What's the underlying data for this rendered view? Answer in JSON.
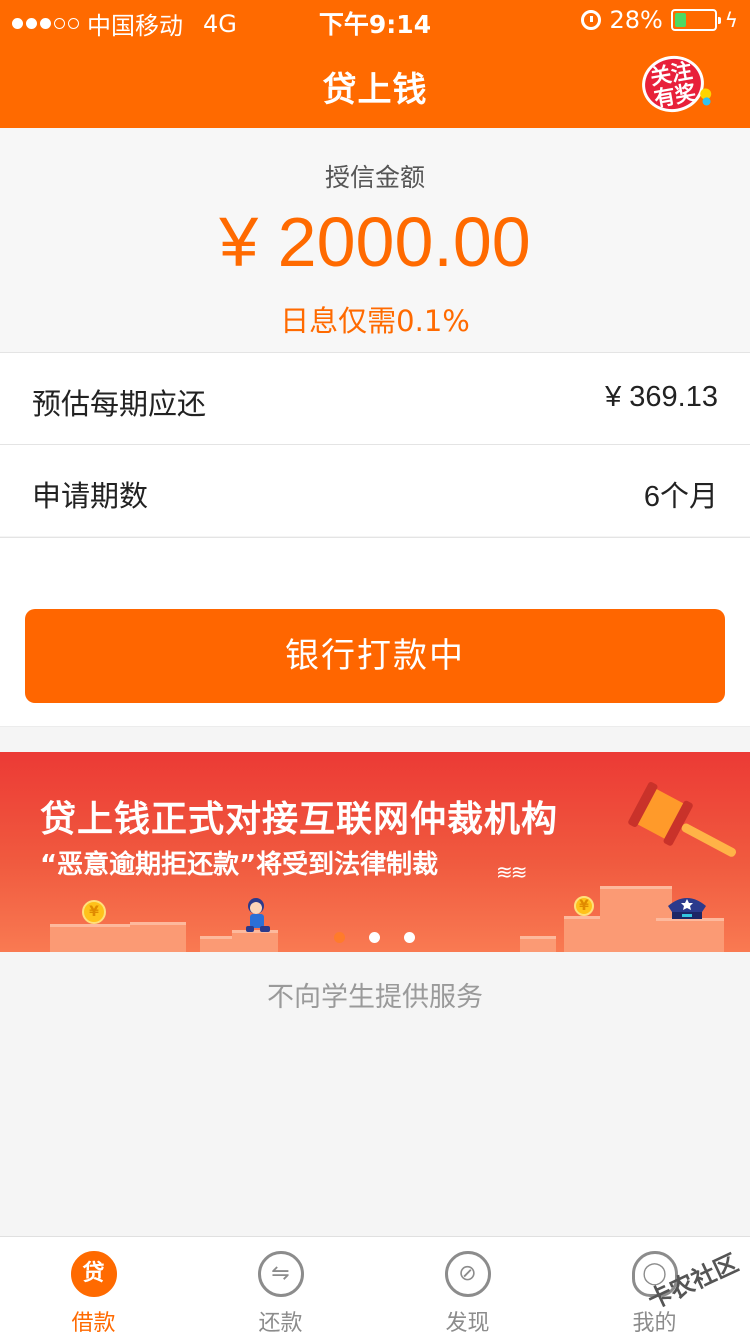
{
  "status_bar": {
    "carrier": "中国移动",
    "network": "4G",
    "time": "下午9:14",
    "battery": "28%",
    "battery_level": 0.28
  },
  "header": {
    "title": "贷上钱",
    "promo_badge": "关注有奖"
  },
  "credit": {
    "label": "授信金额",
    "amount": "¥ 2000.00",
    "rate": "日息仅需0.1%"
  },
  "rows": [
    {
      "label": "预估每期应还",
      "value": "¥ 369.13"
    },
    {
      "label": "申请期数",
      "value": "6个月"
    }
  ],
  "action_button": {
    "label": "银行打款中"
  },
  "banner": {
    "title": "贷上钱正式对接互联网仲裁机构",
    "subtitle": "“恶意逾期拒还款”将受到法律制裁",
    "pages": 3,
    "active_page": 1
  },
  "notice": "不向学生提供服务",
  "tabbar": {
    "tabs": [
      {
        "label": "借款",
        "icon": "loan-icon",
        "glyph": "贷",
        "active": true
      },
      {
        "label": "还款",
        "icon": "repay-icon",
        "glyph": "⇋",
        "active": false
      },
      {
        "label": "发现",
        "icon": "compass-icon",
        "glyph": "⊘",
        "active": false
      },
      {
        "label": "我的",
        "icon": "user-icon",
        "glyph": "◯",
        "active": false
      }
    ]
  },
  "watermark": "卡农社区",
  "colors": {
    "accent": "#ff6a00",
    "banner": "#ec3a35"
  }
}
